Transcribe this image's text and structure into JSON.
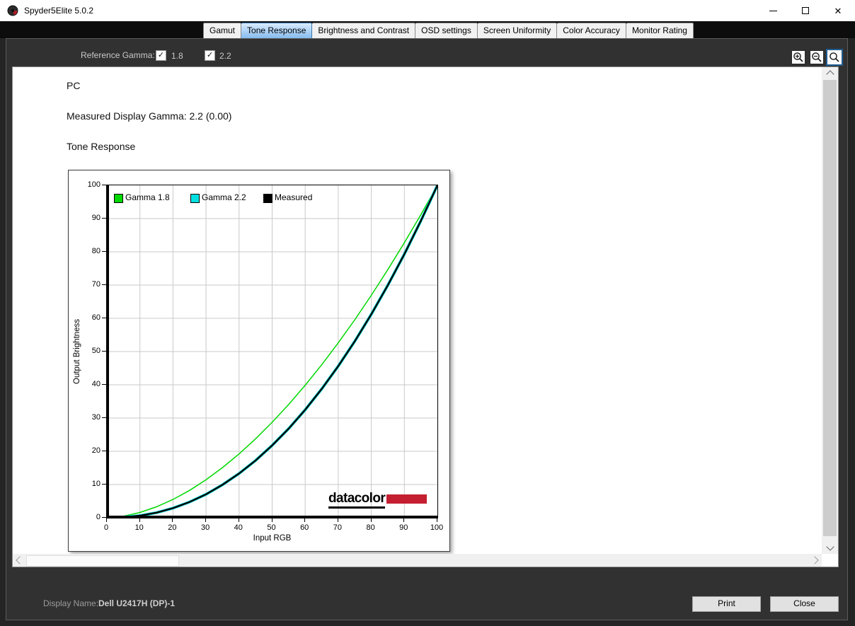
{
  "window": {
    "title": "Spyder5Elite 5.0.2"
  },
  "icons": {
    "app": "spyder-logo",
    "minimize": "minimize-dash",
    "maximize": "maximize-box",
    "close": "✕",
    "check": "✓",
    "zoom_in": "magnifier-plus",
    "zoom_out": "magnifier-minus",
    "zoom_reset": "magnifier",
    "scroll_up": "chevron-up",
    "scroll_down": "chevron-down",
    "scroll_left": "chevron-left",
    "scroll_right": "chevron-right"
  },
  "tabs": [
    {
      "label": "Gamut",
      "selected": false
    },
    {
      "label": "Tone Response",
      "selected": true
    },
    {
      "label": "Brightness and Contrast",
      "selected": false
    },
    {
      "label": "OSD settings",
      "selected": false
    },
    {
      "label": "Screen Uniformity",
      "selected": false
    },
    {
      "label": "Color Accuracy",
      "selected": false
    },
    {
      "label": "Monitor Rating",
      "selected": false
    }
  ],
  "toolbar": {
    "label": "Reference Gamma:",
    "checkboxes": [
      {
        "label": "1.8",
        "checked": true
      },
      {
        "label": "2.2",
        "checked": true
      }
    ],
    "zoom_buttons": [
      {
        "name": "zoom-in",
        "active": false
      },
      {
        "name": "zoom-out",
        "active": false
      },
      {
        "name": "zoom-reset",
        "active": true
      }
    ]
  },
  "report": {
    "platform": "PC",
    "gamma_line": "Measured Display Gamma: 2.2 (0.00)",
    "section": "Tone Response"
  },
  "chart_data": {
    "type": "line",
    "xlabel": "Input RGB",
    "ylabel": "Output Brightness",
    "xlim": [
      0,
      100
    ],
    "ylim": [
      0,
      100
    ],
    "xticks": [
      0,
      10,
      20,
      30,
      40,
      50,
      60,
      70,
      80,
      90,
      100
    ],
    "yticks": [
      0,
      10,
      20,
      30,
      40,
      50,
      60,
      70,
      80,
      90,
      100
    ],
    "grid": true,
    "grid_color": "#c9c9c9",
    "legend_position": "top-left-inside",
    "x": [
      0,
      5,
      10,
      15,
      20,
      25,
      30,
      35,
      40,
      45,
      50,
      55,
      60,
      65,
      70,
      75,
      80,
      85,
      90,
      95,
      100
    ],
    "series": [
      {
        "name": "Gamma 1.8",
        "color": "#00d800",
        "line_width": 1.5,
        "values": [
          0,
          0.46,
          1.59,
          3.29,
          5.52,
          8.24,
          11.45,
          15.11,
          19.22,
          23.76,
          28.72,
          34.1,
          39.87,
          46.05,
          52.62,
          59.58,
          66.92,
          74.64,
          82.73,
          91.18,
          100
        ]
      },
      {
        "name": "Gamma 2.2",
        "color": "#00e0e0",
        "line_width": 4,
        "values": [
          0,
          0.14,
          0.63,
          1.54,
          2.9,
          4.74,
          7.07,
          9.93,
          13.32,
          17.26,
          21.76,
          26.84,
          32.5,
          38.76,
          45.62,
          53.11,
          61.22,
          69.94,
          79.3,
          89.32,
          100
        ]
      },
      {
        "name": "Measured",
        "color": "#000000",
        "line_width": 2.4,
        "values": [
          0,
          0.14,
          0.63,
          1.54,
          2.9,
          4.74,
          7.07,
          9.93,
          13.32,
          17.26,
          21.76,
          26.84,
          32.5,
          38.76,
          45.62,
          53.11,
          61.22,
          69.94,
          79.3,
          89.32,
          100
        ]
      }
    ]
  },
  "logo": {
    "text": "datacolor",
    "bar_color": "#c41f30"
  },
  "statusbar": {
    "label": "Display Name:",
    "value": "Dell U2417H (DP)-1"
  },
  "actions": {
    "print": "Print",
    "close": "Close"
  }
}
